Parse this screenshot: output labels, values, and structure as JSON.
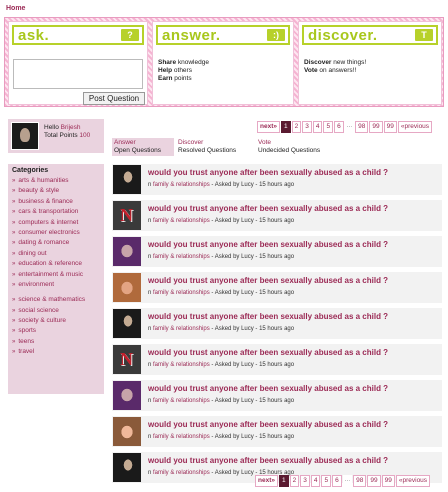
{
  "nav": {
    "home": "Home"
  },
  "banner": {
    "ask": {
      "title": "ask.",
      "icon": "question-icon",
      "icon_glyph": "?",
      "button": "Post Question"
    },
    "answer": {
      "title": "answer.",
      "icon": "smile-icon",
      "icon_glyph": ":)",
      "lines": [
        {
          "bold": "Share",
          "rest": " knowledge"
        },
        {
          "bold": "Help",
          "rest": " others"
        },
        {
          "bold": "Earn",
          "rest": " points"
        }
      ]
    },
    "discover": {
      "title": "discover.",
      "icon": "pin-icon",
      "icon_glyph": "T",
      "lines": [
        {
          "bold": "Discover",
          "rest": " new things!"
        },
        {
          "bold": "Vote",
          "rest": " on answers!!"
        }
      ]
    }
  },
  "user": {
    "hello": "Hello",
    "name": "Brijesh",
    "points_label": "Total Points",
    "points": "100"
  },
  "pager": {
    "next": "next»",
    "pages": [
      "1",
      "2",
      "3",
      "4",
      "5",
      "6"
    ],
    "dots": "...",
    "tail": [
      "98",
      "99",
      "99"
    ],
    "prev": "«previous"
  },
  "tabs": [
    {
      "title": "Answer",
      "sub": "Open Questions"
    },
    {
      "title": "Discover",
      "sub": "Resolved Questions"
    },
    {
      "title": "Vote",
      "sub": "Undecided Questions"
    }
  ],
  "categories": {
    "title": "Categories",
    "group1": [
      "arts & humanities",
      "beauty & style",
      "business & finance",
      "cars & transportation",
      "computers & internet",
      "consumer electronics",
      "dating & romance",
      "dining out",
      "education & reference",
      "entertainment & music",
      "environment"
    ],
    "group2": [
      "science & mathematics",
      "social science",
      "society & culture",
      "sports",
      "teens",
      "travel"
    ]
  },
  "questions": [
    {
      "title": "would you trust anyone after been sexually abused as a child ?",
      "in": "n",
      "cat": "family & relationships",
      "asked": " - Asked by Lucy - 15 hours ago",
      "thumb": "dark"
    },
    {
      "title": "would you trust anyone after been sexually abused as a child ?",
      "in": "n",
      "cat": "family & relationships",
      "asked": " - Asked by Lucy - 15 hours ago",
      "thumb": "n"
    },
    {
      "title": "would you trust anyone after been sexually abused as a child ?",
      "in": "n",
      "cat": "family & relationships",
      "asked": " - Asked by Lucy - 15 hours ago",
      "thumb": "purple"
    },
    {
      "title": "would you trust anyone after been sexually abused as a child ?",
      "in": "n",
      "cat": "family & relationships",
      "asked": " - Asked by Lucy - 15 hours ago",
      "thumb": "orange"
    },
    {
      "title": "would you trust anyone after been sexually abused as a child ?",
      "in": "n",
      "cat": "family & relationships",
      "asked": " - Asked by Lucy - 15 hours ago",
      "thumb": "dark"
    },
    {
      "title": "would you trust anyone after been sexually abused as a child ?",
      "in": "n",
      "cat": "family & relationships",
      "asked": " - Asked by Lucy - 15 hours ago",
      "thumb": "n"
    },
    {
      "title": "would you trust anyone after been sexually abused as a child ?",
      "in": "n",
      "cat": "family & relationships",
      "asked": " - Asked by Lucy - 15 hours ago",
      "thumb": "purple"
    },
    {
      "title": "would you trust anyone after been sexually abused as a child ?",
      "in": "n",
      "cat": "family & relationships",
      "asked": " - Asked by Lucy - 15 hours ago",
      "thumb": "warm"
    },
    {
      "title": "would you trust anyone after been sexually abused as a child ?",
      "in": "n",
      "cat": "family & relationships",
      "asked": " - Asked by Lucy - 15 hours ago",
      "thumb": "dark"
    }
  ],
  "colors": {
    "accent": "#9b2a55",
    "green": "#b7d12a",
    "pink": "#ead3df"
  }
}
